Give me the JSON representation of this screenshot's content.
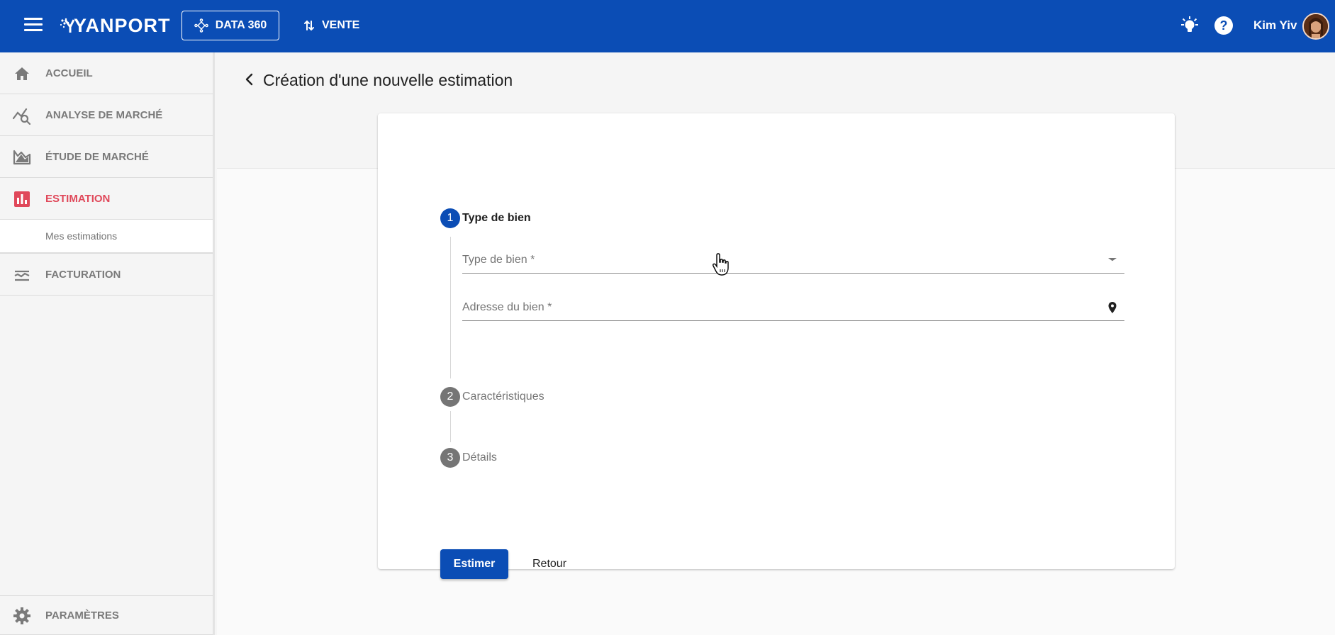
{
  "topbar": {
    "logo_text": "YANPORT",
    "data360_label": "DATA 360",
    "vente_label": "VENTE",
    "user_name": "Kim Yiv",
    "icons": [
      "menu-icon",
      "data360-icon",
      "swap-vertical-icon",
      "lightbulb-icon",
      "help-icon",
      "avatar"
    ]
  },
  "sidebar": {
    "items": [
      {
        "label": "ACCUEIL",
        "icon": "home-icon"
      },
      {
        "label": "ANALYSE DE MARCHÉ",
        "icon": "chart-search-icon"
      },
      {
        "label": "ÉTUDE DE MARCHÉ",
        "icon": "area-chart-icon"
      },
      {
        "label": "ESTIMATION",
        "icon": "bar-chart-icon",
        "active": true
      },
      {
        "label": "FACTURATION",
        "icon": "billing-icon"
      }
    ],
    "sub_item": "Mes estimations",
    "bottom_item": "PARAMÈTRES",
    "active_color": "#e0485a"
  },
  "main": {
    "title": "Création d'une nouvelle estimation",
    "steps": [
      {
        "number": "1",
        "label": "Type de bien",
        "state": "active"
      },
      {
        "number": "2",
        "label": "Caractéristiques",
        "state": "inactive"
      },
      {
        "number": "3",
        "label": "Détails",
        "state": "inactive"
      }
    ],
    "fields": {
      "type_de_bien": "Type de bien *",
      "adresse_du_bien": "Adresse du bien *"
    },
    "buttons": {
      "estimer": "Estimer",
      "retour": "Retour"
    }
  },
  "colors": {
    "brand": "#0b4db5",
    "accent_red": "#e0485a"
  }
}
